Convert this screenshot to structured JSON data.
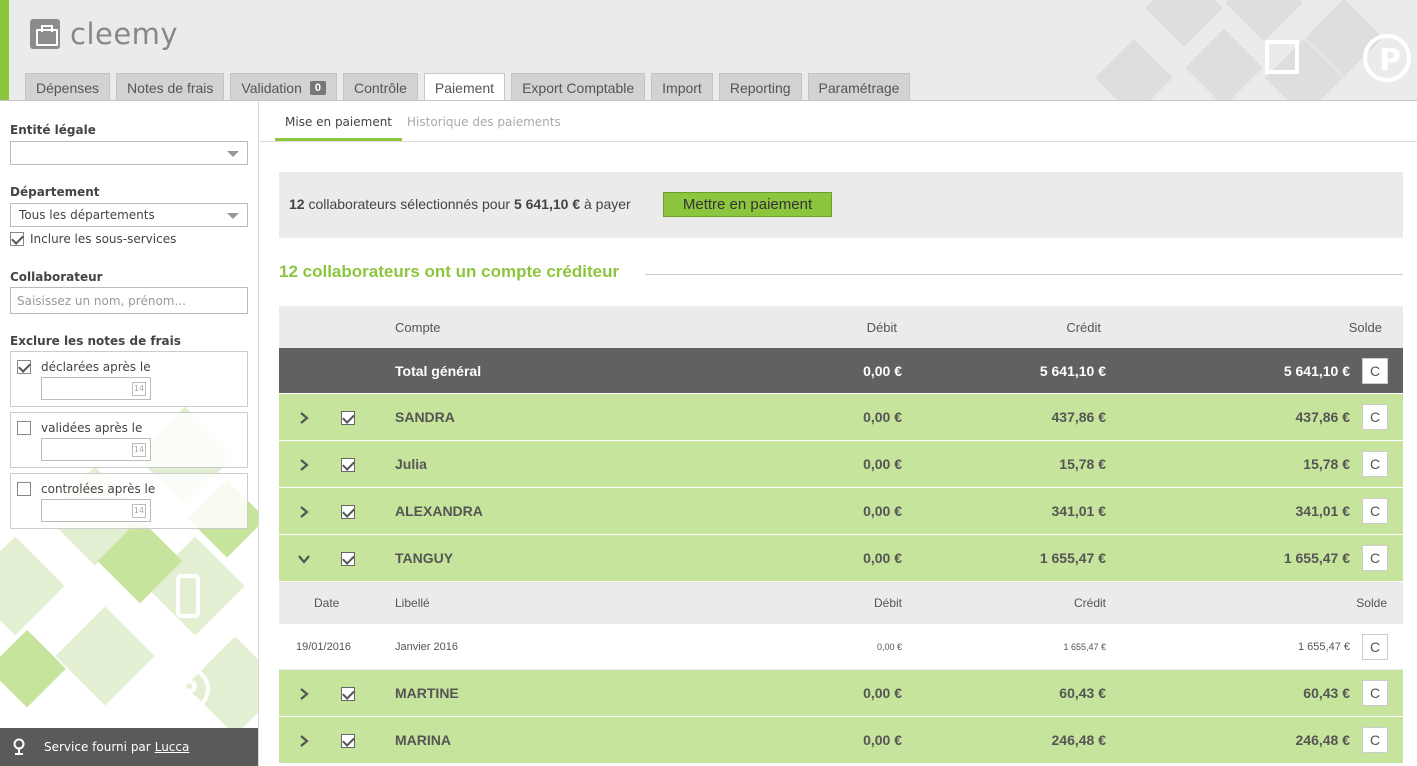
{
  "app": {
    "name": "cleemy",
    "brand_color": "#8cc63e"
  },
  "tabs": [
    {
      "label": "Dépenses"
    },
    {
      "label": "Notes de frais"
    },
    {
      "label": "Validation",
      "badge": "0"
    },
    {
      "label": "Contrôle"
    },
    {
      "label": "Paiement",
      "active": true
    },
    {
      "label": "Export Comptable"
    },
    {
      "label": "Import"
    },
    {
      "label": "Reporting"
    },
    {
      "label": "Paramétrage"
    }
  ],
  "sidebar": {
    "entity_label": "Entité légale",
    "entity_value": "",
    "department_label": "Département",
    "department_value": "Tous les départements",
    "include_subservices": "Inclure les sous-services",
    "collaborator_label": "Collaborateur",
    "collaborator_placeholder": "Saisissez un nom, prénom...",
    "exclude_label": "Exclure les notes de frais",
    "exclude_options": [
      {
        "label": "déclarées après le",
        "checked": true
      },
      {
        "label": "validées après le",
        "checked": false
      },
      {
        "label": "controlées après le",
        "checked": false
      }
    ],
    "calendar_glyph": "14",
    "footer_text": "Service fourni par",
    "footer_link": "Lucca"
  },
  "subtabs": {
    "active": "Mise en paiement",
    "history": "Historique des paiements"
  },
  "summary": {
    "count": "12",
    "text_middle": "collaborateurs sélectionnés pour",
    "amount": "5 641,10 €",
    "text_end": "à payer",
    "button": "Mettre en paiement"
  },
  "section_title": "12 collaborateurs ont un compte créditeur",
  "table": {
    "headers": {
      "account": "Compte",
      "debit": "Débit",
      "credit": "Crédit",
      "balance": "Solde"
    },
    "total": {
      "label": "Total général",
      "debit": "0,00 €",
      "credit": "5 641,10 €",
      "balance": "5 641,10 €"
    },
    "c_label": "C",
    "employees_before": [
      {
        "name": "SANDRA",
        "debit": "0,00 €",
        "credit": "437,86 €",
        "balance": "437,86 €"
      },
      {
        "name": "Julia",
        "debit": "0,00 €",
        "credit": "15,78 €",
        "balance": "15,78 €"
      },
      {
        "name": "ALEXANDRA",
        "debit": "0,00 €",
        "credit": "341,01 €",
        "balance": "341,01 €"
      }
    ],
    "expanded": {
      "name": "TANGUY",
      "debit": "0,00 €",
      "credit": "1 655,47 €",
      "balance": "1 655,47 €"
    },
    "detail_headers": {
      "date": "Date",
      "label": "Libellé",
      "debit": "Débit",
      "credit": "Crédit",
      "balance": "Solde"
    },
    "detail_rows": [
      {
        "date": "19/01/2016",
        "label": "Janvier 2016",
        "debit": "0,00 €",
        "credit": "1 655,47 €",
        "balance": "1 655,47 €"
      }
    ],
    "employees_after": [
      {
        "name": "MARTINE",
        "debit": "0,00 €",
        "credit": "60,43 €",
        "balance": "60,43 €"
      },
      {
        "name": "MARINA",
        "debit": "0,00 €",
        "credit": "246,48 €",
        "balance": "246,48 €"
      }
    ]
  }
}
